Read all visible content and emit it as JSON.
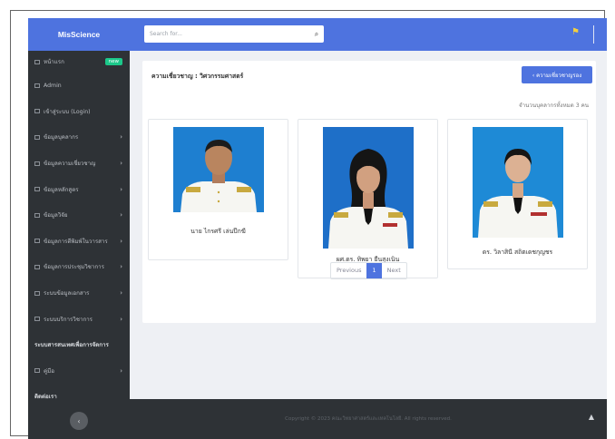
{
  "brand": "MisScience",
  "sidebar": {
    "items": [
      {
        "label": "หน้าแรก",
        "badge": "new",
        "chevron": false
      },
      {
        "label": "Admin",
        "chevron": false
      },
      {
        "label": "เข้าสู่ระบบ (Login)",
        "chevron": false
      },
      {
        "label": "ข้อมูลบุคลากร",
        "chevron": true
      },
      {
        "label": "ข้อมูลความเชี่ยวชาญ",
        "chevron": true
      },
      {
        "label": "ข้อมูลหลักสูตร",
        "chevron": true
      },
      {
        "label": "ข้อมูลวิจัย",
        "chevron": true
      },
      {
        "label": "ข้อมูลการตีพิมพ์ในวารสาร",
        "chevron": true
      },
      {
        "label": "ข้อมูลการประชุมวิชาการ",
        "chevron": true
      },
      {
        "label": "ระบบข้อมูลเอกสาร",
        "chevron": true
      },
      {
        "label": "ระบบบริการวิชาการ",
        "chevron": true
      }
    ],
    "heading": "ระบบสารสนเทศเพื่อการจัดการ",
    "manual": {
      "label": "คู่มือ",
      "chevron": true
    },
    "contact": "ติดต่อเรา",
    "toggle_glyph": "‹"
  },
  "topbar": {
    "search_placeholder": "Search for...",
    "search_icon": "search-icon",
    "alert_icon": "bell-icon"
  },
  "main": {
    "title": "ความเชี่ยวชาญ : วิศวกรรมศาสตร์",
    "back_button": "‹ ความเชี่ยวชาญรอง",
    "count_text": "จำนวนบุคลากรทั้งหมด 3 คน",
    "people": [
      {
        "name": "นาย ไกรศรี เล่นป๊กฆี",
        "photo_bg": "#1e7fd0"
      },
      {
        "name": "ผศ.ดร. ทิพยา ยืนสุงเนิน",
        "photo_bg": "#1e6fc8"
      },
      {
        "name": "ดร. วิลาสินี สถิตเดชกุญชร",
        "photo_bg": "#1e8ad6"
      }
    ],
    "pagination": {
      "previous": "Previous",
      "current": "1",
      "next": "Next"
    }
  },
  "footer": {
    "text": "Copyright © 2023 คณะวิทยาศาสตร์และเทคโนโลยี. All rights reserved.",
    "scroll_top_glyph": "▲"
  },
  "colors": {
    "primary": "#4e73df",
    "sidebar": "#2e3236",
    "background": "#eef0f4",
    "success": "#1cc88a"
  }
}
